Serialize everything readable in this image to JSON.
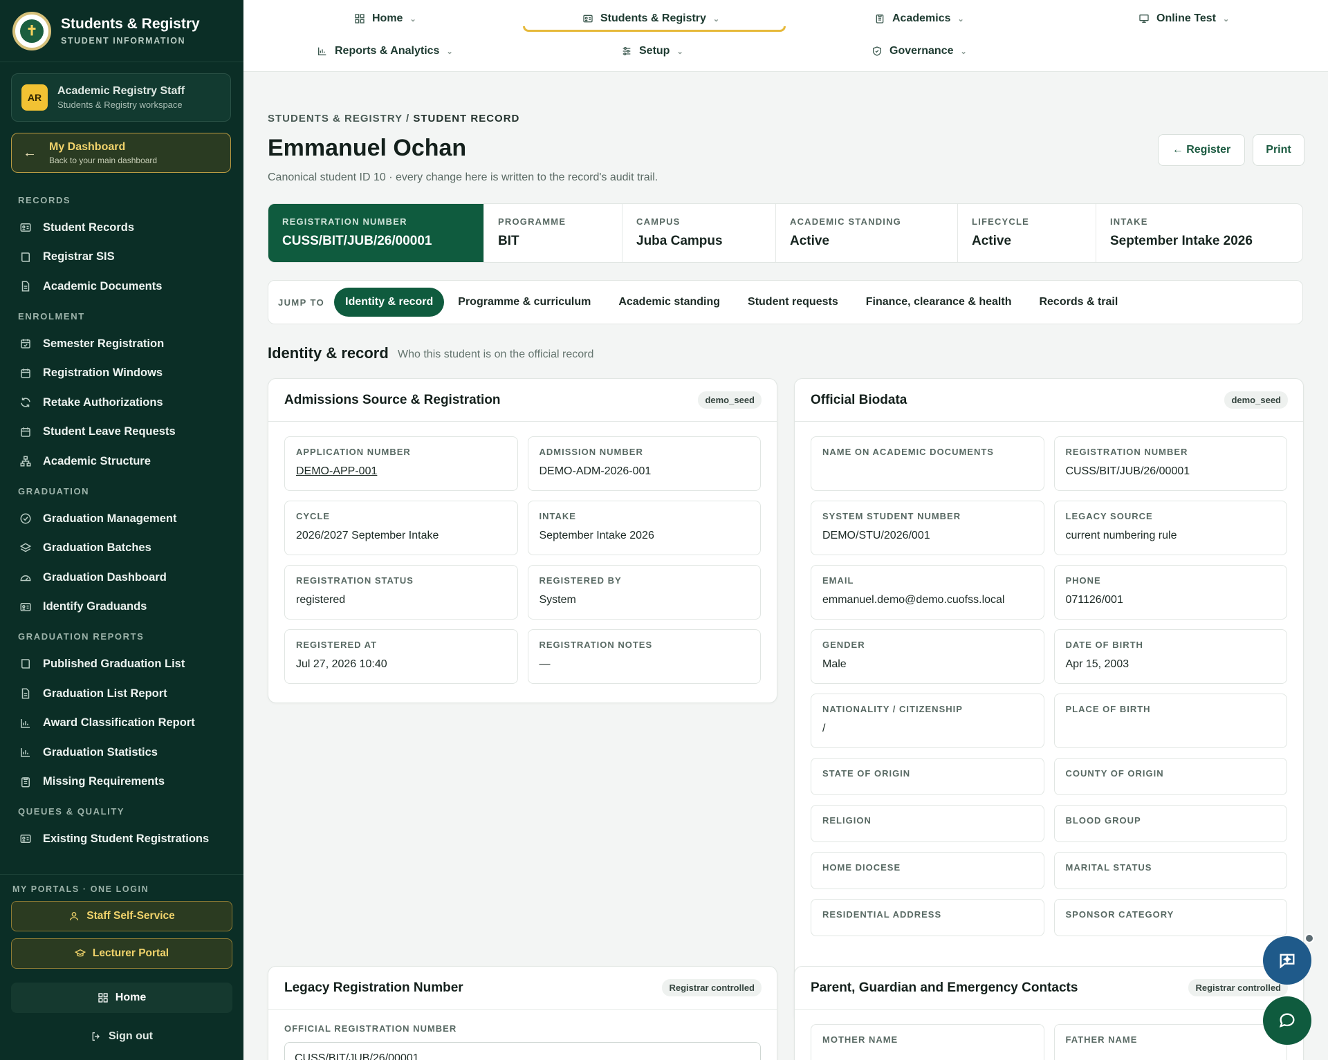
{
  "brand": {
    "title": "Students & Registry",
    "subtitle": "STUDENT INFORMATION",
    "logo_glyph": "✝"
  },
  "user": {
    "initials": "AR",
    "name": "Academic Registry Staff",
    "workspace": "Students & Registry workspace"
  },
  "dashboard_link": {
    "title": "My Dashboard",
    "subtitle": "Back to your main dashboard"
  },
  "sidebar": {
    "sections": [
      {
        "title": "RECORDS",
        "items": [
          {
            "label": "Student Records",
            "icon": "id-card-icon"
          },
          {
            "label": "Registrar SIS",
            "icon": "book-icon"
          },
          {
            "label": "Academic Documents",
            "icon": "document-icon"
          }
        ]
      },
      {
        "title": "ENROLMENT",
        "items": [
          {
            "label": "Semester Registration",
            "icon": "calendar-check-icon"
          },
          {
            "label": "Registration Windows",
            "icon": "calendar-icon"
          },
          {
            "label": "Retake Authorizations",
            "icon": "refresh-icon"
          },
          {
            "label": "Student Leave Requests",
            "icon": "calendar-icon"
          },
          {
            "label": "Academic Structure",
            "icon": "hierarchy-icon"
          }
        ]
      },
      {
        "title": "GRADUATION",
        "items": [
          {
            "label": "Graduation Management",
            "icon": "check-circle-icon"
          },
          {
            "label": "Graduation Batches",
            "icon": "layers-icon"
          },
          {
            "label": "Graduation Dashboard",
            "icon": "gauge-icon"
          },
          {
            "label": "Identify Graduands",
            "icon": "id-card-icon"
          }
        ]
      },
      {
        "title": "GRADUATION REPORTS",
        "items": [
          {
            "label": "Published Graduation List",
            "icon": "book-icon"
          },
          {
            "label": "Graduation List Report",
            "icon": "document-icon"
          },
          {
            "label": "Award Classification Report",
            "icon": "bar-chart-icon"
          },
          {
            "label": "Graduation Statistics",
            "icon": "bar-chart-icon"
          },
          {
            "label": "Missing Requirements",
            "icon": "clipboard-icon"
          }
        ]
      },
      {
        "title": "QUEUES & QUALITY",
        "items": [
          {
            "label": "Existing Student Registrations",
            "icon": "id-card-icon"
          }
        ]
      }
    ]
  },
  "portals": {
    "label": "MY PORTALS · ONE LOGIN",
    "staff": "Staff Self-Service",
    "lecturer": "Lecturer Portal",
    "home": "Home",
    "signout": "Sign out"
  },
  "topnav": {
    "home": "Home",
    "students": "Students & Registry",
    "academics": "Academics",
    "online_test": "Online Test",
    "reports": "Reports & Analytics",
    "setup": "Setup",
    "governance": "Governance"
  },
  "page": {
    "crumb_section": "STUDENTS & REGISTRY /",
    "crumb_current": "STUDENT RECORD",
    "title": "Emmanuel Ochan",
    "subtitle": "Canonical student ID 10 · every change here is written to the record's audit trail.",
    "register_button": "← Register",
    "print_button": "Print"
  },
  "summary": [
    {
      "label": "REGISTRATION NUMBER",
      "value": "CUSS/BIT/JUB/26/00001"
    },
    {
      "label": "PROGRAMME",
      "value": "BIT"
    },
    {
      "label": "CAMPUS",
      "value": "Juba Campus"
    },
    {
      "label": "ACADEMIC STANDING",
      "value": "Active"
    },
    {
      "label": "LIFECYCLE",
      "value": "Active"
    },
    {
      "label": "INTAKE",
      "value": "September Intake 2026"
    }
  ],
  "jump": {
    "label": "JUMP TO",
    "tabs": [
      "Identity & record",
      "Programme & curriculum",
      "Academic standing",
      "Student requests",
      "Finance, clearance & health",
      "Records & trail"
    ]
  },
  "section": {
    "title": "Identity & record",
    "subtitle": "Who this student is on the official record"
  },
  "admissions": {
    "title": "Admissions Source & Registration",
    "tag": "demo_seed",
    "fields": [
      {
        "label": "APPLICATION NUMBER",
        "value": "DEMO-APP-001"
      },
      {
        "label": "ADMISSION NUMBER",
        "value": "DEMO-ADM-2026-001"
      },
      {
        "label": "CYCLE",
        "value": "2026/2027 September Intake"
      },
      {
        "label": "INTAKE",
        "value": "September Intake 2026"
      },
      {
        "label": "REGISTRATION STATUS",
        "value": "registered"
      },
      {
        "label": "REGISTERED BY",
        "value": "System"
      },
      {
        "label": "REGISTERED AT",
        "value": "Jul 27, 2026 10:40"
      },
      {
        "label": "REGISTRATION NOTES",
        "value": "—"
      }
    ]
  },
  "biodata": {
    "title": "Official Biodata",
    "tag": "demo_seed",
    "fields": [
      {
        "label": "NAME ON ACADEMIC DOCUMENTS",
        "value": ""
      },
      {
        "label": "REGISTRATION NUMBER",
        "value": "CUSS/BIT/JUB/26/00001"
      },
      {
        "label": "SYSTEM STUDENT NUMBER",
        "value": "DEMO/STU/2026/001"
      },
      {
        "label": "LEGACY SOURCE",
        "value": "current numbering rule"
      },
      {
        "label": "EMAIL",
        "value": "emmanuel.demo@demo.cuofss.local"
      },
      {
        "label": "PHONE",
        "value": "071126/001"
      },
      {
        "label": "GENDER",
        "value": "Male"
      },
      {
        "label": "DATE OF BIRTH",
        "value": "Apr 15, 2003"
      },
      {
        "label": "NATIONALITY / CITIZENSHIP",
        "value": "/"
      },
      {
        "label": "PLACE OF BIRTH",
        "value": ""
      },
      {
        "label": "STATE OF ORIGIN",
        "value": ""
      },
      {
        "label": "COUNTY OF ORIGIN",
        "value": ""
      },
      {
        "label": "RELIGION",
        "value": ""
      },
      {
        "label": "BLOOD GROUP",
        "value": ""
      },
      {
        "label": "HOME DIOCESE",
        "value": ""
      },
      {
        "label": "MARITAL STATUS",
        "value": ""
      },
      {
        "label": "RESIDENTIAL ADDRESS",
        "value": ""
      },
      {
        "label": "SPONSOR CATEGORY",
        "value": ""
      }
    ]
  },
  "legacy": {
    "title": "Legacy Registration Number",
    "tag": "Registrar controlled",
    "field_label": "OFFICIAL REGISTRATION NUMBER",
    "field_value": "CUSS/BIT/JUB/26/00001"
  },
  "contacts": {
    "title": "Parent, Guardian and Emergency Contacts",
    "tag": "Registrar controlled",
    "mother_label": "MOTHER NAME",
    "father_label": "FATHER NAME"
  },
  "colors": {
    "sidebar": "#0b2e26",
    "accent": "#0f5b3e",
    "gold": "#e6b93a",
    "fab_blue": "#1f5a8a",
    "fab_green": "#0f5b3e"
  }
}
